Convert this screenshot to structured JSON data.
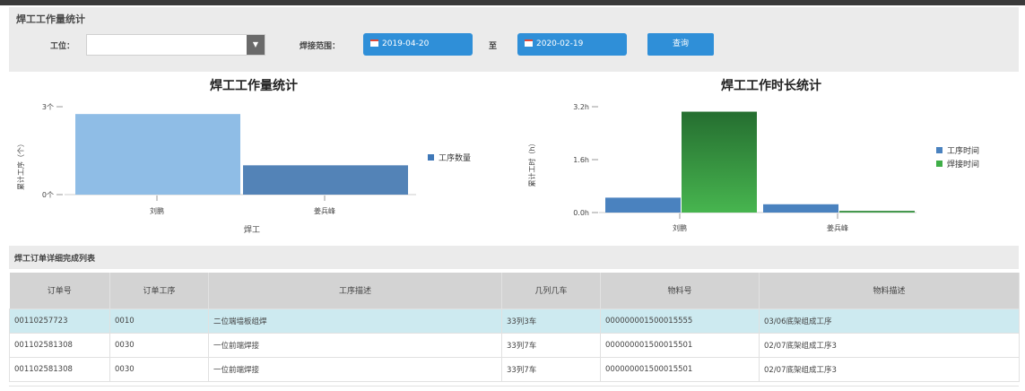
{
  "panel": {
    "title": "焊工工作量统计"
  },
  "filter": {
    "station_label": "工位：",
    "select_value": "",
    "range_label": "焊接范围：",
    "start_date": "2019-04-20",
    "to_label": "至",
    "end_date": "2020-02-19",
    "query_label": "查询"
  },
  "colors": {
    "accent": "#2f8fd8",
    "header_bg": "#ebebeb",
    "selected_row": "#cdeaf0"
  },
  "charts": [
    {
      "type": "bar",
      "title": "焊工工作量统计",
      "ylabel": "累计工序（个）",
      "xlabel": "焊工",
      "yticks": [
        "3个",
        "0个"
      ],
      "ylim": [
        0,
        3
      ],
      "categories": [
        "刘鹏",
        "姜兵峰"
      ],
      "series": [
        {
          "name": "工序数量",
          "values": [
            2.75,
            1.0
          ],
          "colors": [
            "#8fbde6",
            "#5383b7"
          ]
        }
      ]
    },
    {
      "type": "bar",
      "title": "焊工工作时长统计",
      "ylabel": "累计工时（h）",
      "yticks": [
        "3.2h",
        "1.6h",
        "0.0h"
      ],
      "ylim": [
        0,
        3.2
      ],
      "categories": [
        "刘鹏",
        "姜兵峰"
      ],
      "series": [
        {
          "name": "工序时间",
          "values": [
            0.45,
            0.25
          ],
          "color": "#4a82bf"
        },
        {
          "name": "焊接时间",
          "values": [
            3.05,
            0.05
          ],
          "color": "#3fae48"
        }
      ]
    }
  ],
  "table": {
    "section_title": "焊工订单详细完成列表",
    "columns": [
      "订单号",
      "订单工序",
      "工序描述",
      "几列几车",
      "物料号",
      "物料描述"
    ],
    "rows": [
      [
        "00110257723",
        "0010",
        "二位端墙板组焊",
        "33列3车",
        "000000001500015555",
        "03/06底架组成工序"
      ],
      [
        "001102581308",
        "0030",
        "一位前端焊接",
        "33列7车",
        "000000001500015501",
        "02/07底架组成工序3"
      ],
      [
        "001102581308",
        "0030",
        "一位前端焊接",
        "33列7车",
        "000000001500015501",
        "02/07底架组成工序3"
      ]
    ]
  }
}
